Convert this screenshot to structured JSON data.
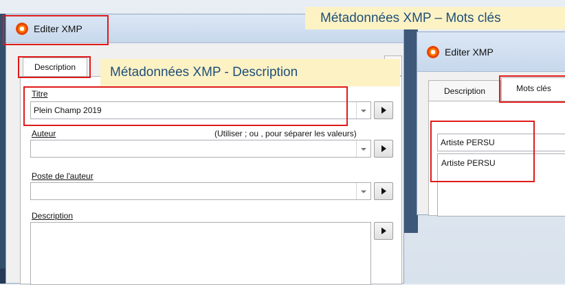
{
  "left_window": {
    "title": "Editer XMP",
    "tabs": [
      "Description"
    ],
    "callout": "Métadonnées XMP - Description",
    "fields": {
      "titre": {
        "label": "Titre",
        "value": "Plein Champ 2019"
      },
      "auteur": {
        "label": "Auteur",
        "hint": "(Utiliser ; ou , pour séparer les valeurs)",
        "value": ""
      },
      "poste": {
        "label": "Poste de l'auteur",
        "value": ""
      },
      "description": {
        "label": "Description",
        "value": ""
      }
    }
  },
  "right_window": {
    "title": "Editer XMP",
    "callout": "Métadonnées XMP – Mots clés",
    "tabs": [
      "Description",
      "Mots clés"
    ],
    "keyword_input": "Artiste PERSU",
    "keywords": [
      "Artiste PERSU"
    ]
  },
  "colors": {
    "callout_bg": "#fdf2c4",
    "callout_text": "#1f4f79",
    "highlight": "#e01818"
  }
}
